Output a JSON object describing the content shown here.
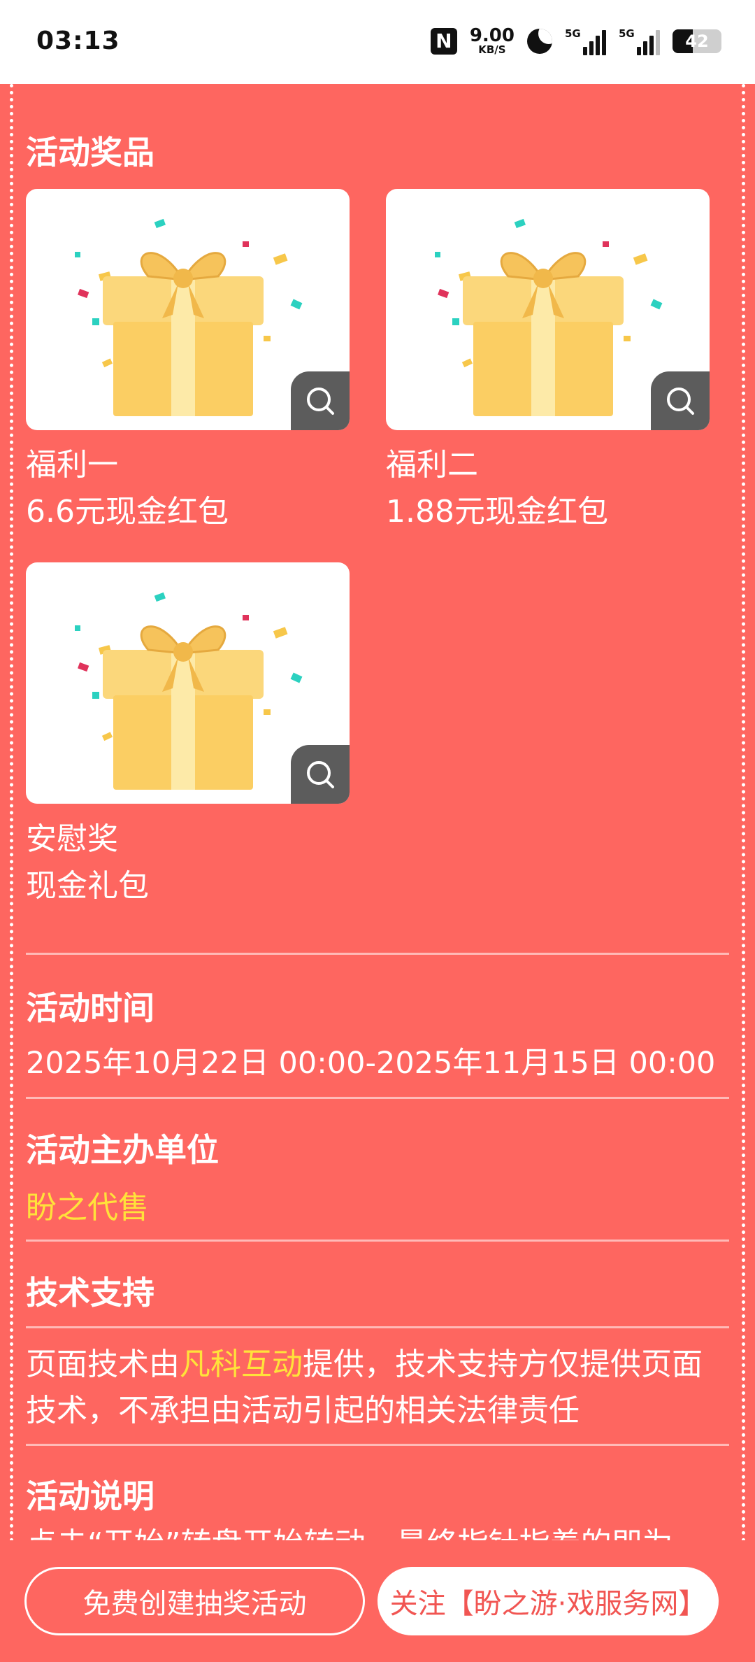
{
  "status_bar": {
    "time": "03:13",
    "net_speed_value": "9.00",
    "net_speed_unit": "KB/S",
    "sim1_label": "5G",
    "sim2_label": "5G",
    "battery": "42"
  },
  "prizes": {
    "title": "活动奖品",
    "items": [
      {
        "name": "福利一",
        "value": "6.6元现金红包"
      },
      {
        "name": "福利二",
        "value": "1.88元现金红包"
      },
      {
        "name": "安慰奖",
        "value": "现金礼包"
      }
    ]
  },
  "time_section": {
    "title": "活动时间",
    "value": "2025年10月22日 00:00-2025年11月15日 00:00"
  },
  "organizer": {
    "title": "活动主办单位",
    "value": "盼之代售"
  },
  "tech": {
    "title": "技术支持",
    "text_before": "页面技术由",
    "provider": "凡科互动",
    "text_after": "提供，技术支持方仅提供页面技术，不承担由活动引起的相关法律责任"
  },
  "description": {
    "title": "活动说明",
    "partial_text": "点击“开始”转盘开始转动，最终指针指着的即为"
  },
  "bottom": {
    "create_label": "免费创建抽奖活动",
    "follow_label": "关注【盼之游·戏服务网】"
  },
  "colors": {
    "background": "#fe6660",
    "highlight": "#ffe23a",
    "follow_text": "#f15552"
  }
}
